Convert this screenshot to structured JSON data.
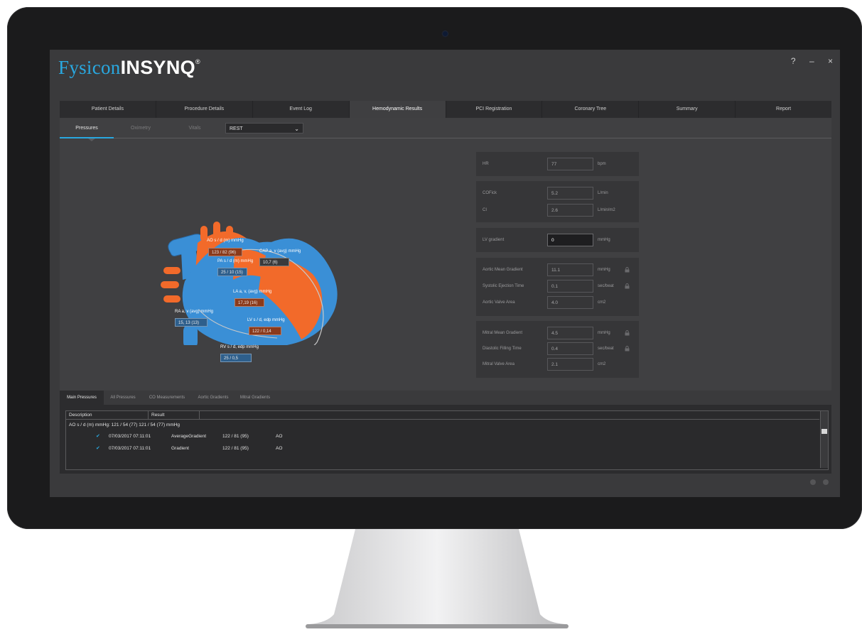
{
  "app": {
    "brand_part1": "Fysicon",
    "brand_part2": "INSYNQ",
    "brand_mark": "®",
    "help": "?",
    "minimize": "–",
    "close": "×"
  },
  "main_tabs": [
    {
      "label": "Patient Details",
      "active": false
    },
    {
      "label": "Procedure Details",
      "active": false
    },
    {
      "label": "Event Log",
      "active": false
    },
    {
      "label": "Hemodynamic Results",
      "active": true
    },
    {
      "label": "PCI Registration",
      "active": false
    },
    {
      "label": "Coronary Tree",
      "active": false
    },
    {
      "label": "Summary",
      "active": false
    },
    {
      "label": "Report",
      "active": false
    }
  ],
  "sub_tabs": [
    {
      "label": "Pressures",
      "active": true
    },
    {
      "label": "Oximetry",
      "active": false
    },
    {
      "label": "Vitals",
      "active": false
    }
  ],
  "condition_select": {
    "value": "REST"
  },
  "heart": {
    "ao_label": "AO s / d (m) mmHg",
    "ao_value": "123 / 82 (96)",
    "cap_label": "CAP a, v (avg) mmHg",
    "cap_value": "10,7 (6)",
    "pa_label": "PA s / d (m) mmHg",
    "pa_value": "25 / 10 (15)",
    "la_label": "LA a, v, (avg) mmHg",
    "la_value": "17,19 (16)",
    "ra_label": "RA a, v (avg) mmHg",
    "ra_value": "15, 13 (13)",
    "lv_label": "LV s / d, edp mmHg",
    "lv_value": "122 / 0,14",
    "rv_label": "RV s / d, edp mmHg",
    "rv_value": "25 / 0,5"
  },
  "results": {
    "hr": {
      "label": "HR",
      "value": "77",
      "unit": "bpm"
    },
    "cofick": {
      "label": "COFick",
      "value": "5.2",
      "unit": "L/min"
    },
    "ci": {
      "label": "CI",
      "value": "2.6",
      "unit": "L/min/m2"
    },
    "lv_gradient": {
      "label": "LV gradient",
      "value": "0",
      "unit": "mmHg"
    },
    "aortic_mean_gradient": {
      "label": "Aortic Mean Gradient",
      "value": "11.1",
      "unit": "mmHg"
    },
    "systolic_ejection_time": {
      "label": "Systolic Ejection Time",
      "value": "0.1",
      "unit": "sec/beat"
    },
    "aortic_valve_area": {
      "label": "Aortic Valve Area",
      "value": "4.0",
      "unit": "cm2"
    },
    "mitral_mean_gradient": {
      "label": "Mitral Mean Gradient",
      "value": "4.5",
      "unit": "mmHg"
    },
    "diastolic_filling_time": {
      "label": "Diastolic Filling Time",
      "value": "0.4",
      "unit": "sec/beat"
    },
    "mitral_valve_area": {
      "label": "Mitral Valve Area",
      "value": "2.1",
      "unit": "cm2"
    }
  },
  "bottom_tabs": [
    {
      "label": "Main Pressures",
      "active": true
    },
    {
      "label": "All Pressures",
      "active": false
    },
    {
      "label": "CO Measurements",
      "active": false
    },
    {
      "label": "Aortic Gradients",
      "active": false
    },
    {
      "label": "Mitral Gradients",
      "active": false
    }
  ],
  "grid": {
    "columns": [
      "Description",
      "Result"
    ],
    "group_row": "AO s / d (m) mmHg: 121 / 54 (77) 121 / 54 (77) mmHg",
    "rows": [
      {
        "checked": true,
        "timestamp": "07/03/2017 07:11:01",
        "type": "AverageGradient",
        "value": "122 / 81 (95)",
        "site": "AO"
      },
      {
        "checked": true,
        "timestamp": "07/03/2017 07:11:01",
        "type": "Gradient",
        "value": "122 / 81 (95)",
        "site": "AO"
      }
    ]
  },
  "colors": {
    "accent": "#29a8e0",
    "heart_orange": "#f26a2a",
    "heart_blue": "#3a8fd6"
  }
}
